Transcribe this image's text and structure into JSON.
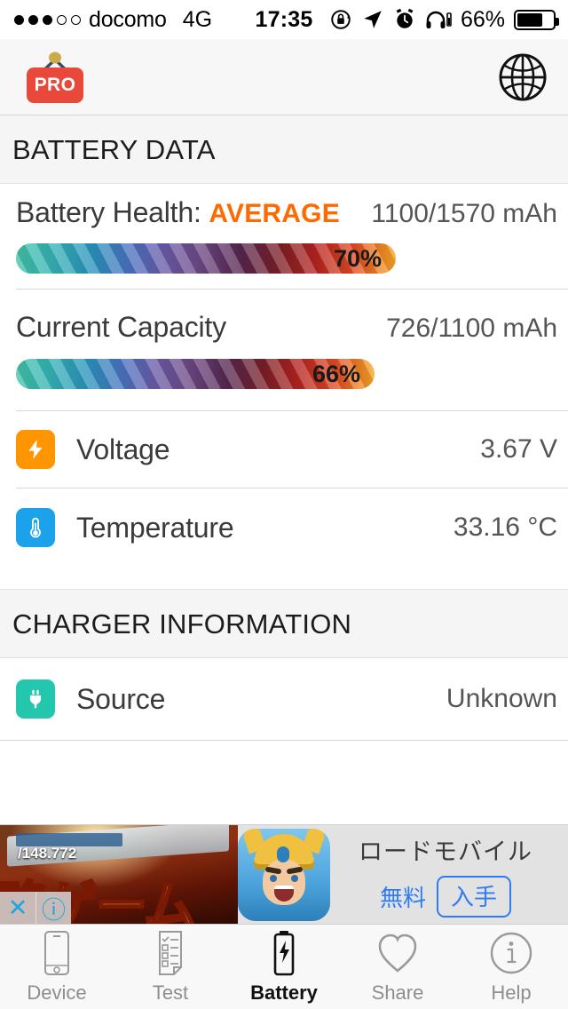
{
  "statusbar": {
    "signal_filled": 3,
    "signal_empty": 2,
    "carrier": "docomo",
    "network": "4G",
    "time": "17:35",
    "battery_percent": "66%",
    "battery_level": 66,
    "icons": [
      "rotation-lock-icon",
      "location-arrow-icon",
      "alarm-clock-icon",
      "headphones-icon"
    ]
  },
  "appbar": {
    "pro_label": "PRO",
    "globe_icon": "globe-icon"
  },
  "sections": [
    {
      "title": "BATTERY DATA"
    },
    {
      "title": "CHARGER INFORMATION"
    }
  ],
  "battery": {
    "health_label": "Battery Health:",
    "health_status": "AVERAGE",
    "health_status_color": "#ff6a00",
    "health_capacity": "1100/1570 mAh",
    "health_percent_text": "70%",
    "health_percent": 70,
    "capacity_label": "Current Capacity",
    "capacity_value": "726/1100 mAh",
    "capacity_percent_text": "66%",
    "capacity_percent": 66,
    "rows": [
      {
        "icon": "bolt-icon",
        "icon_color": "#ff9500",
        "label": "Voltage",
        "value": "3.67 V"
      },
      {
        "icon": "thermometer-icon",
        "icon_color": "#1ca2ea",
        "label": "Temperature",
        "value": "33.16 °C"
      }
    ]
  },
  "charger": {
    "rows": [
      {
        "icon": "plug-icon",
        "icon_color": "#24c6ad",
        "label": "Source",
        "value": "Unknown"
      }
    ]
  },
  "ad": {
    "close_icon": "close-icon",
    "info_icon": "info-icon",
    "art_number": "/148.772",
    "art_text": "略ゲーム",
    "app_icon": "warrior-app-icon",
    "title": "ロードモバイル",
    "price": "無料",
    "cta": "入手"
  },
  "tabbar": {
    "tabs": [
      {
        "label": "Device",
        "icon": "phone-icon",
        "active": false
      },
      {
        "label": "Test",
        "icon": "checklist-icon",
        "active": false
      },
      {
        "label": "Battery",
        "icon": "battery-bolt-icon",
        "active": true
      },
      {
        "label": "Share",
        "icon": "heart-icon",
        "active": false
      },
      {
        "label": "Help",
        "icon": "info-circle-icon",
        "active": false
      }
    ]
  }
}
